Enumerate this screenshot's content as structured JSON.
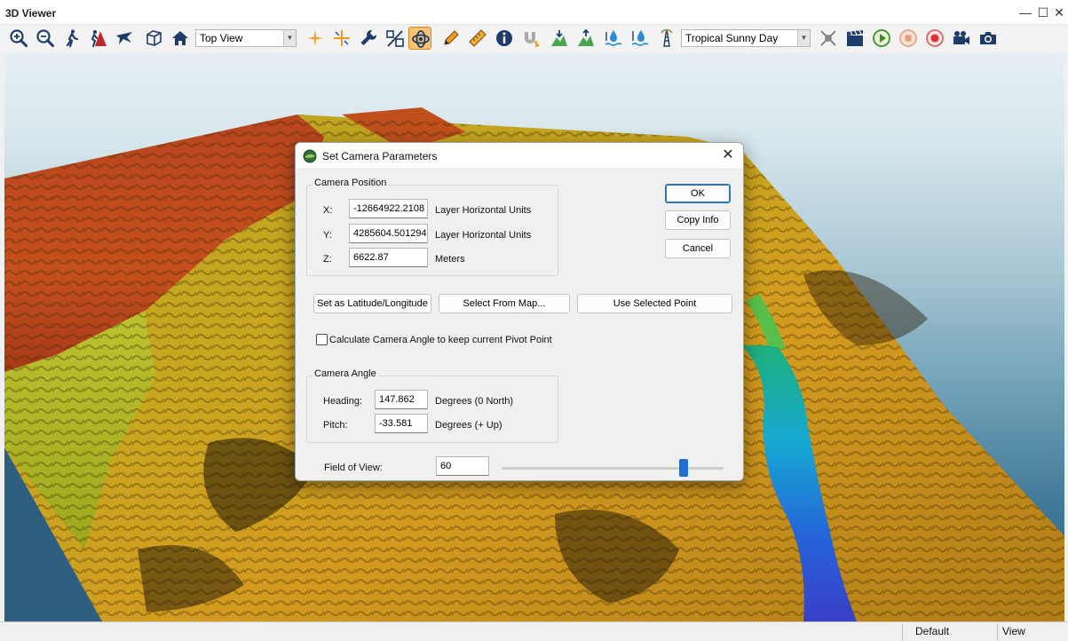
{
  "window": {
    "title": "3D Viewer",
    "controls": {
      "minimize": "—",
      "maximize": "☐",
      "close": "✕"
    }
  },
  "toolbar": {
    "view_select": "Top View",
    "sky_select": "Tropical Sunny Day",
    "icons": [
      "zoom-in-icon",
      "zoom-out-icon",
      "walk-icon",
      "walk-to-point-icon",
      "flyover-icon",
      "3d-box-icon",
      "home-icon",
      "crosshair-icon",
      "center-cross-icon",
      "wrench-icon",
      "terrain-scale-icon",
      "pivot-icon",
      "pencil-icon",
      "ruler-icon",
      "info-icon",
      "magnet-icon",
      "terrain-down-icon",
      "terrain-up-icon",
      "water-level-icon",
      "water-level-up-icon",
      "tower-icon",
      "antenna-icon",
      "movie-clapper-icon",
      "play-icon",
      "stop-icon",
      "record-icon",
      "video-camera-icon",
      "photo-camera-icon"
    ]
  },
  "dialog": {
    "title": "Set Camera Parameters",
    "close": "✕",
    "camera_position": {
      "legend": "Camera Position",
      "x_label": "X:",
      "x_value": "-12664922.2108",
      "x_unit": "Layer Horizontal Units",
      "y_label": "Y:",
      "y_value": "4285604.501294",
      "y_unit": "Layer Horizontal Units",
      "z_label": "Z:",
      "z_value": "6622.87",
      "z_unit": "Meters"
    },
    "buttons": {
      "ok": "OK",
      "copy_info": "Copy Info",
      "cancel": "Cancel",
      "set_lat_lon": "Set as Latitude/Longitude",
      "select_from_map": "Select From Map...",
      "use_selected_point": "Use Selected Point"
    },
    "pivot_checkbox": {
      "label": "Calculate Camera Angle to keep current Pivot Point",
      "checked": false
    },
    "camera_angle": {
      "legend": "Camera Angle",
      "heading_label": "Heading:",
      "heading_value": "147.862",
      "heading_unit": "Degrees (0 North)",
      "pitch_label": "Pitch:",
      "pitch_value": "-33.581",
      "pitch_unit": "Degrees (+ Up)"
    },
    "fov": {
      "label": "Field of View:",
      "value": "60",
      "slider_fraction": 0.82
    }
  },
  "statusbar": {
    "left": "Default",
    "right": "View"
  },
  "colors": {
    "accent_active": "#f8c374",
    "slider_thumb": "#1f6fd0",
    "default_button_border": "#2b76c7"
  }
}
